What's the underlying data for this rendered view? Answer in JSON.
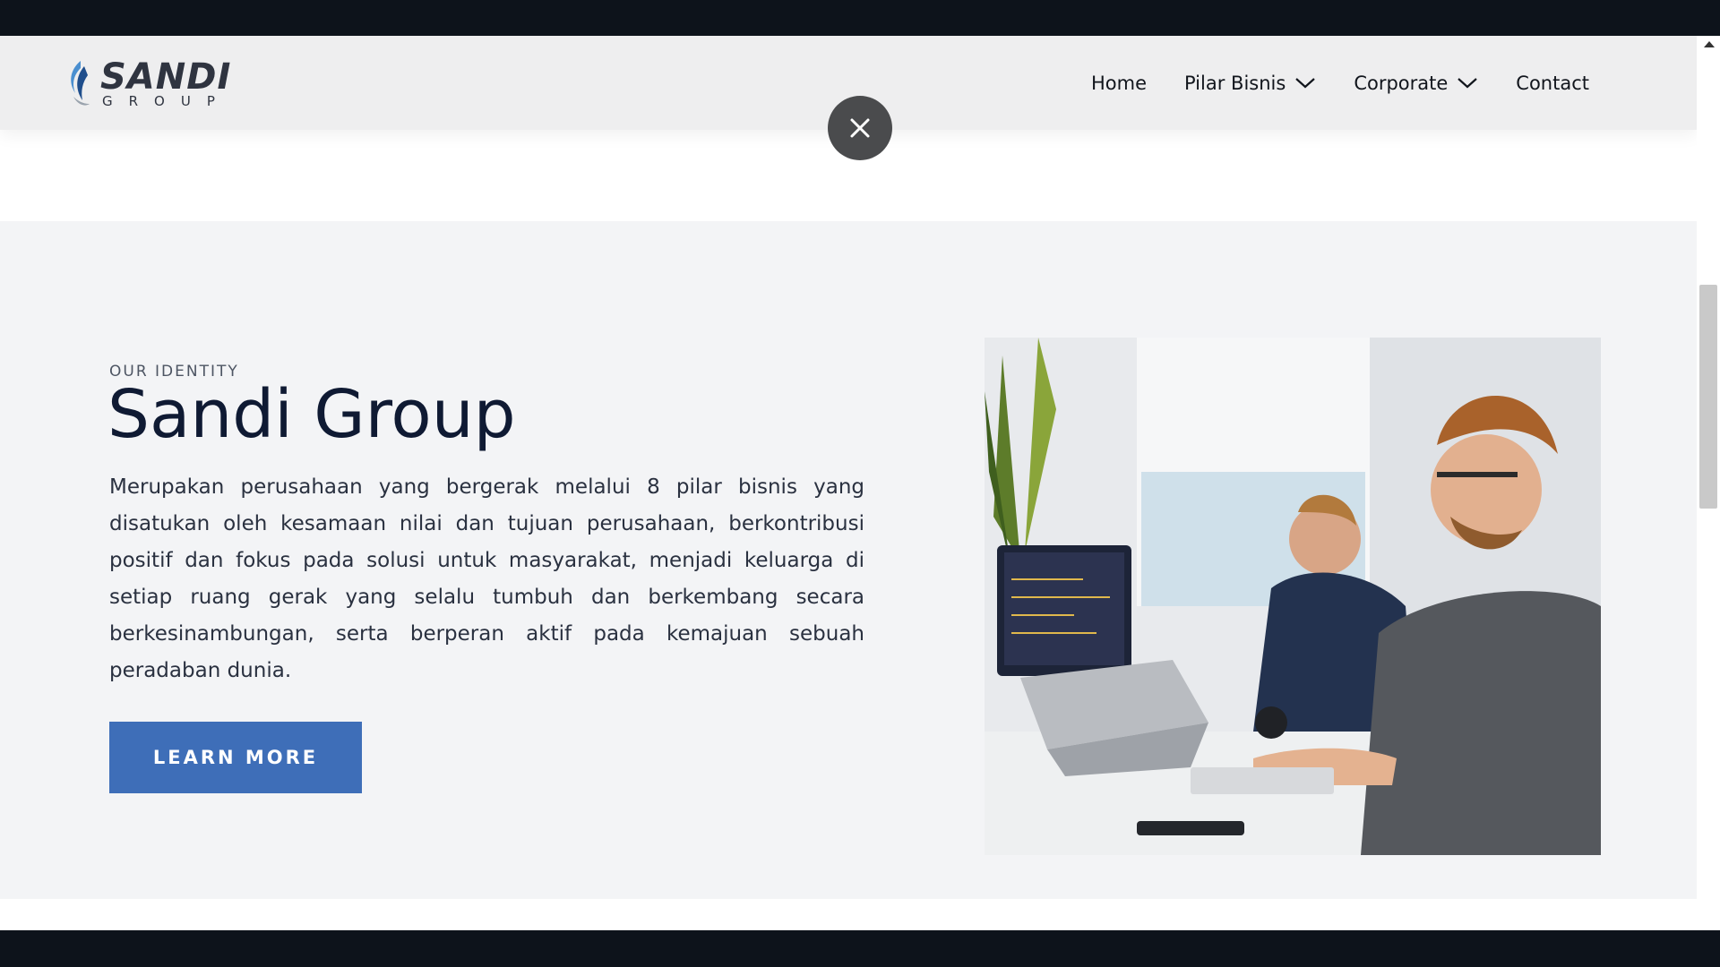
{
  "header": {
    "logo_word": "SANDI",
    "logo_sub": "GROUP",
    "nav": [
      {
        "label": "Home",
        "icon": ""
      },
      {
        "label": "Pilar Bisnis",
        "icon": "chevron-down-icon"
      },
      {
        "label": "Corporate",
        "icon": "chevron-down-icon"
      },
      {
        "label": "Contact",
        "icon": ""
      }
    ]
  },
  "overlay": {
    "close_icon": "close-icon"
  },
  "identity": {
    "eyebrow": "OUR IDENTITY",
    "title": "Sandi Group",
    "body": "Merupakan perusahaan yang bergerak melalui 8 pilar bisnis yang disatukan oleh kesamaan nilai dan tujuan perusahaan, berkontribusi positif dan fokus pada solusi untuk masyarakat, menjadi keluarga di setiap ruang gerak yang selalu tumbuh dan berkembang secara berkesinambungan, serta berperan aktif pada kemajuan sebuah peradaban dunia.",
    "button": "LEARN MORE"
  },
  "colors": {
    "accent": "#3e6eb8",
    "heading": "#0f1a33",
    "section_bg": "#f3f4f6",
    "dark_bar": "#0d131b"
  }
}
